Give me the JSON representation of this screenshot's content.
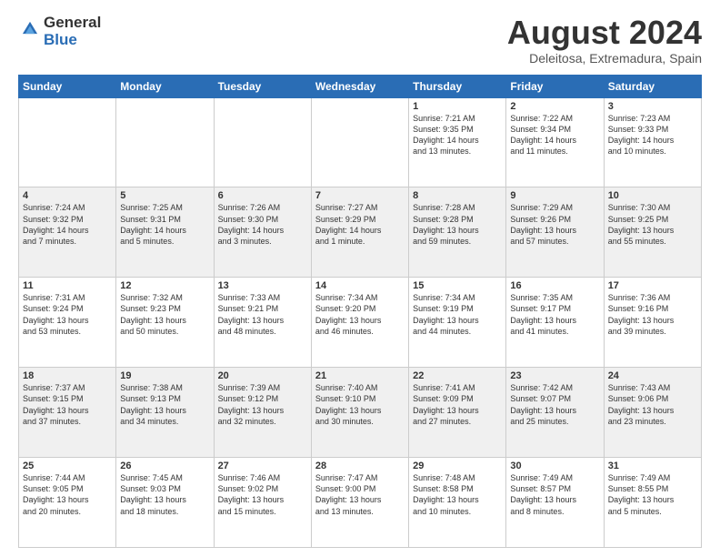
{
  "logo": {
    "general": "General",
    "blue": "Blue"
  },
  "header": {
    "month": "August 2024",
    "location": "Deleitosa, Extremadura, Spain"
  },
  "days_of_week": [
    "Sunday",
    "Monday",
    "Tuesday",
    "Wednesday",
    "Thursday",
    "Friday",
    "Saturday"
  ],
  "weeks": [
    [
      {
        "day": "",
        "info": ""
      },
      {
        "day": "",
        "info": ""
      },
      {
        "day": "",
        "info": ""
      },
      {
        "day": "",
        "info": ""
      },
      {
        "day": "1",
        "info": "Sunrise: 7:21 AM\nSunset: 9:35 PM\nDaylight: 14 hours\nand 13 minutes."
      },
      {
        "day": "2",
        "info": "Sunrise: 7:22 AM\nSunset: 9:34 PM\nDaylight: 14 hours\nand 11 minutes."
      },
      {
        "day": "3",
        "info": "Sunrise: 7:23 AM\nSunset: 9:33 PM\nDaylight: 14 hours\nand 10 minutes."
      }
    ],
    [
      {
        "day": "4",
        "info": "Sunrise: 7:24 AM\nSunset: 9:32 PM\nDaylight: 14 hours\nand 7 minutes."
      },
      {
        "day": "5",
        "info": "Sunrise: 7:25 AM\nSunset: 9:31 PM\nDaylight: 14 hours\nand 5 minutes."
      },
      {
        "day": "6",
        "info": "Sunrise: 7:26 AM\nSunset: 9:30 PM\nDaylight: 14 hours\nand 3 minutes."
      },
      {
        "day": "7",
        "info": "Sunrise: 7:27 AM\nSunset: 9:29 PM\nDaylight: 14 hours\nand 1 minute."
      },
      {
        "day": "8",
        "info": "Sunrise: 7:28 AM\nSunset: 9:28 PM\nDaylight: 13 hours\nand 59 minutes."
      },
      {
        "day": "9",
        "info": "Sunrise: 7:29 AM\nSunset: 9:26 PM\nDaylight: 13 hours\nand 57 minutes."
      },
      {
        "day": "10",
        "info": "Sunrise: 7:30 AM\nSunset: 9:25 PM\nDaylight: 13 hours\nand 55 minutes."
      }
    ],
    [
      {
        "day": "11",
        "info": "Sunrise: 7:31 AM\nSunset: 9:24 PM\nDaylight: 13 hours\nand 53 minutes."
      },
      {
        "day": "12",
        "info": "Sunrise: 7:32 AM\nSunset: 9:23 PM\nDaylight: 13 hours\nand 50 minutes."
      },
      {
        "day": "13",
        "info": "Sunrise: 7:33 AM\nSunset: 9:21 PM\nDaylight: 13 hours\nand 48 minutes."
      },
      {
        "day": "14",
        "info": "Sunrise: 7:34 AM\nSunset: 9:20 PM\nDaylight: 13 hours\nand 46 minutes."
      },
      {
        "day": "15",
        "info": "Sunrise: 7:34 AM\nSunset: 9:19 PM\nDaylight: 13 hours\nand 44 minutes."
      },
      {
        "day": "16",
        "info": "Sunrise: 7:35 AM\nSunset: 9:17 PM\nDaylight: 13 hours\nand 41 minutes."
      },
      {
        "day": "17",
        "info": "Sunrise: 7:36 AM\nSunset: 9:16 PM\nDaylight: 13 hours\nand 39 minutes."
      }
    ],
    [
      {
        "day": "18",
        "info": "Sunrise: 7:37 AM\nSunset: 9:15 PM\nDaylight: 13 hours\nand 37 minutes."
      },
      {
        "day": "19",
        "info": "Sunrise: 7:38 AM\nSunset: 9:13 PM\nDaylight: 13 hours\nand 34 minutes."
      },
      {
        "day": "20",
        "info": "Sunrise: 7:39 AM\nSunset: 9:12 PM\nDaylight: 13 hours\nand 32 minutes."
      },
      {
        "day": "21",
        "info": "Sunrise: 7:40 AM\nSunset: 9:10 PM\nDaylight: 13 hours\nand 30 minutes."
      },
      {
        "day": "22",
        "info": "Sunrise: 7:41 AM\nSunset: 9:09 PM\nDaylight: 13 hours\nand 27 minutes."
      },
      {
        "day": "23",
        "info": "Sunrise: 7:42 AM\nSunset: 9:07 PM\nDaylight: 13 hours\nand 25 minutes."
      },
      {
        "day": "24",
        "info": "Sunrise: 7:43 AM\nSunset: 9:06 PM\nDaylight: 13 hours\nand 23 minutes."
      }
    ],
    [
      {
        "day": "25",
        "info": "Sunrise: 7:44 AM\nSunset: 9:05 PM\nDaylight: 13 hours\nand 20 minutes."
      },
      {
        "day": "26",
        "info": "Sunrise: 7:45 AM\nSunset: 9:03 PM\nDaylight: 13 hours\nand 18 minutes."
      },
      {
        "day": "27",
        "info": "Sunrise: 7:46 AM\nSunset: 9:02 PM\nDaylight: 13 hours\nand 15 minutes."
      },
      {
        "day": "28",
        "info": "Sunrise: 7:47 AM\nSunset: 9:00 PM\nDaylight: 13 hours\nand 13 minutes."
      },
      {
        "day": "29",
        "info": "Sunrise: 7:48 AM\nSunset: 8:58 PM\nDaylight: 13 hours\nand 10 minutes."
      },
      {
        "day": "30",
        "info": "Sunrise: 7:49 AM\nSunset: 8:57 PM\nDaylight: 13 hours\nand 8 minutes."
      },
      {
        "day": "31",
        "info": "Sunrise: 7:49 AM\nSunset: 8:55 PM\nDaylight: 13 hours\nand 5 minutes."
      }
    ]
  ]
}
